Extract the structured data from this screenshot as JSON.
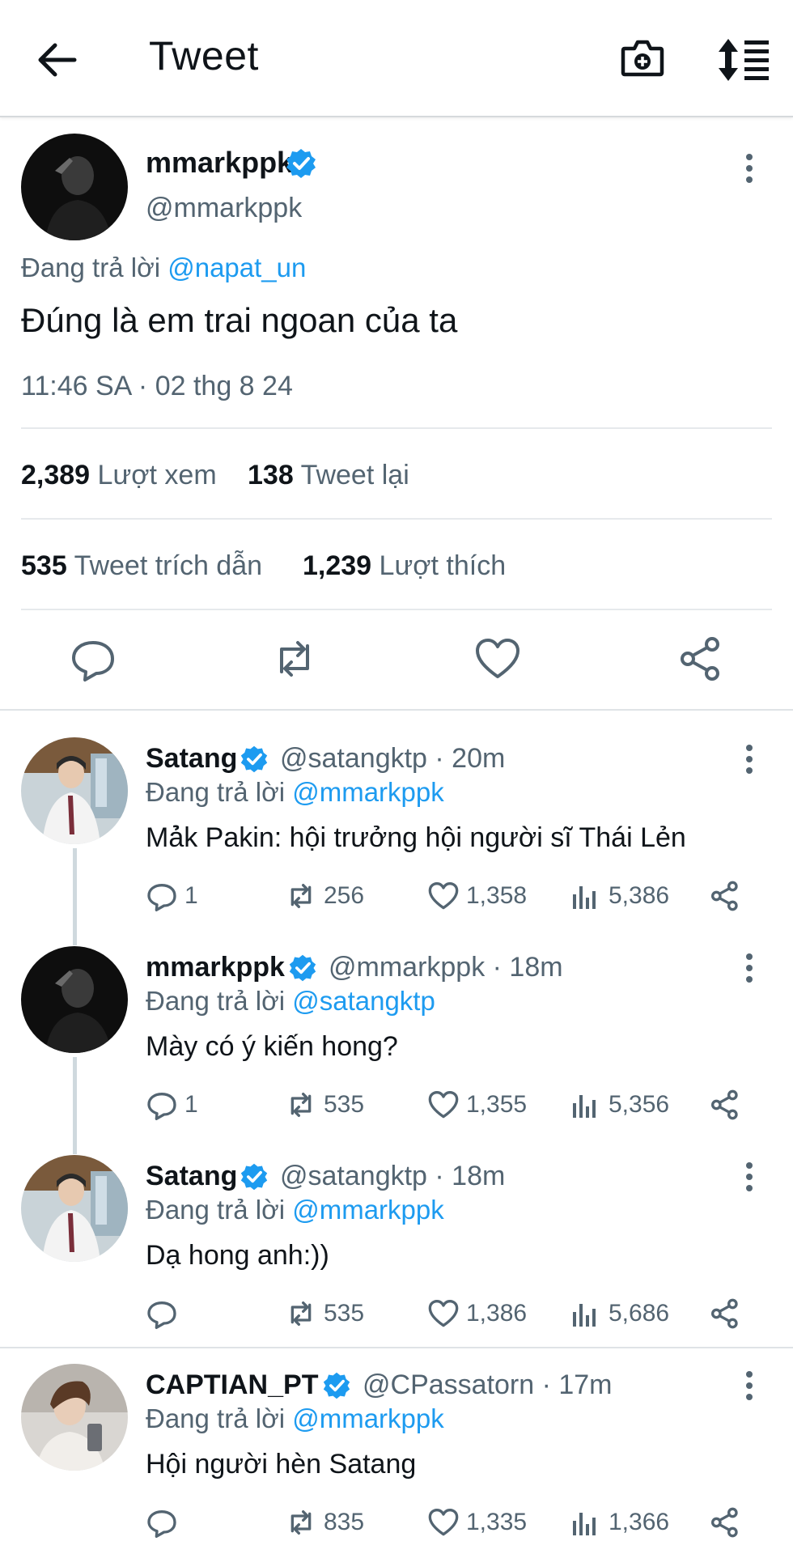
{
  "header": {
    "title": "Tweet"
  },
  "colors": {
    "accent": "#1d9bf0",
    "secondary_text": "#536471",
    "divider": "#e6e9ec"
  },
  "main_tweet": {
    "display_name": "mmarkppk",
    "handle": "@mmarkppk",
    "replying_prefix": "Đang trả lời",
    "replying_to": "@napat_un",
    "text": "Đúng là em trai ngoan của ta",
    "timestamp": "11:46 SA · 02 thg 8 24",
    "stats": {
      "views_count": "2,389",
      "views_label": "Lượt xem",
      "retweets_count": "138",
      "retweets_label": "Tweet lại",
      "quotes_count": "535",
      "quotes_label": "Tweet trích dẫn",
      "likes_count": "1,239",
      "likes_label": "Lượt thích"
    }
  },
  "replies": [
    {
      "display_name": "Satang",
      "handle": "@satangktp · 20m",
      "replying_prefix": "Đang trả lời",
      "replying_to": "@mmarkppk",
      "text": "Mả̉k Pakin: hội trưởng hội người sĩ Thái Lẻn",
      "replies": "1",
      "retweets": "256",
      "likes": "1,358",
      "views": "5,386"
    },
    {
      "display_name": "mmarkppk",
      "handle": "@mmarkppk · 18m",
      "replying_prefix": "Đang trả lời",
      "replying_to": "@satangktp",
      "text": "Mày có ý kiến hong?",
      "replies": "1",
      "retweets": "535",
      "likes": "1,355",
      "views": "5,356"
    },
    {
      "display_name": "Satang",
      "handle": "@satangktp · 18m",
      "replying_prefix": "Đang trả lời",
      "replying_to": "@mmarkppk",
      "text": "Dạ hong anh:))",
      "replies": "",
      "retweets": "535",
      "likes": "1,386",
      "views": "5,686"
    },
    {
      "display_name": "CAPTIAN_PT",
      "handle": "@CPassatorn · 17m",
      "replying_prefix": "Đang trả lời",
      "replying_to": "@mmarkppk",
      "text": "Hội người hèn Satang",
      "replies": "",
      "retweets": "835",
      "likes": "1,335",
      "views": "1,366"
    }
  ]
}
